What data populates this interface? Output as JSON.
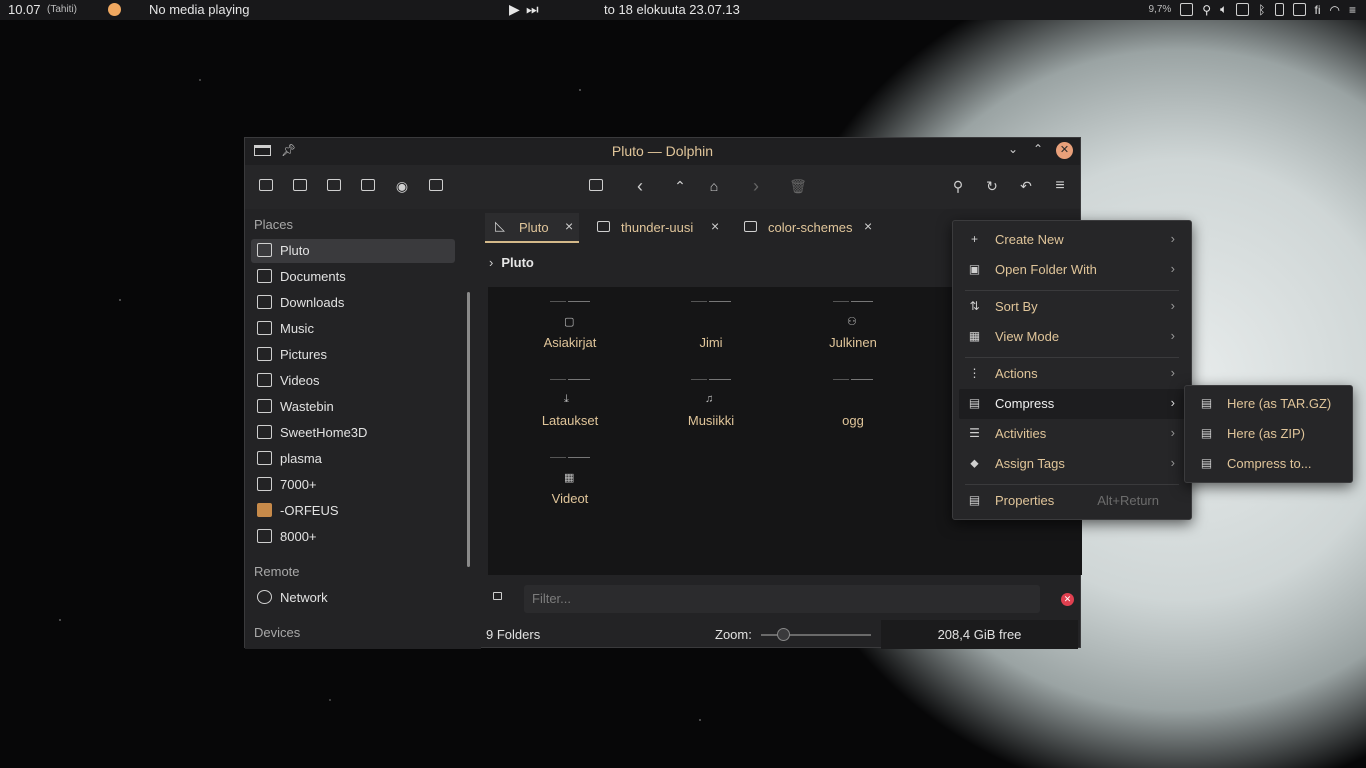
{
  "topbar": {
    "clock": "10.07",
    "timezone": "(Tahiti)",
    "media": "No media playing",
    "datetime": "to 18 elokuuta 23.07.13",
    "cpu": "9,7%",
    "lang": "fi"
  },
  "window": {
    "title": "Pluto — Dolphin"
  },
  "places": {
    "heading": "Places",
    "items": [
      {
        "label": "Pluto",
        "icon": "home-icon"
      },
      {
        "label": "Documents",
        "icon": "documents-icon"
      },
      {
        "label": "Downloads",
        "icon": "downloads-icon"
      },
      {
        "label": "Music",
        "icon": "music-icon"
      },
      {
        "label": "Pictures",
        "icon": "pictures-icon"
      },
      {
        "label": "Videos",
        "icon": "videos-icon"
      },
      {
        "label": "Wastebin",
        "icon": "trash-icon"
      },
      {
        "label": "SweetHome3D",
        "icon": "folder-icon"
      },
      {
        "label": "plasma",
        "icon": "folder-icon"
      },
      {
        "label": "7000+",
        "icon": "folder-icon"
      },
      {
        "label": "-ORFEUS",
        "icon": "app-icon"
      },
      {
        "label": "8000+",
        "icon": "folder-icon"
      }
    ],
    "remote_heading": "Remote",
    "network": "Network",
    "devices_heading": "Devices"
  },
  "tabs": [
    {
      "label": "Pluto"
    },
    {
      "label": "thunder-uusi"
    },
    {
      "label": "color-schemes"
    }
  ],
  "breadcrumb": "Pluto",
  "files": [
    {
      "name": "Asiakirjat",
      "emblem": "▢"
    },
    {
      "name": "Jimi",
      "emblem": ""
    },
    {
      "name": "Julkinen",
      "emblem": "⚇"
    },
    {
      "name": "Lataukset",
      "emblem": "⤓"
    },
    {
      "name": "Musiikki",
      "emblem": "♫"
    },
    {
      "name": "ogg",
      "emblem": ""
    },
    {
      "name": "Videot",
      "emblem": "▦"
    }
  ],
  "filter": {
    "placeholder": "Filter..."
  },
  "status": {
    "count": "9 Folders",
    "zoom_label": "Zoom:",
    "free": "208,4 GiB free",
    "zoom_fraction": 0.2
  },
  "context_menu": {
    "items": [
      {
        "label": "Create New",
        "icon": "+",
        "arrow": "›"
      },
      {
        "label": "Open Folder With",
        "icon": "▣",
        "arrow": "›"
      },
      {
        "label": "Sort By",
        "icon": "⇅",
        "arrow": "›"
      },
      {
        "label": "View Mode",
        "icon": "▦",
        "arrow": "›"
      },
      {
        "label": "Actions",
        "icon": "⋮",
        "arrow": "›"
      },
      {
        "label": "Compress",
        "icon": "▤",
        "arrow": "›"
      },
      {
        "label": "Activities",
        "icon": "☰",
        "arrow": "›"
      },
      {
        "label": "Assign Tags",
        "icon": "⬥",
        "arrow": "›"
      },
      {
        "label": "Properties",
        "icon": "▤",
        "shortcut": "Alt+Return"
      }
    ]
  },
  "submenu": {
    "items": [
      {
        "label": "Here (as TAR.GZ)"
      },
      {
        "label": "Here (as ZIP)"
      },
      {
        "label": "Compress to..."
      }
    ]
  },
  "colors": {
    "accent": "#e0c59a",
    "close": "#e8a07a"
  }
}
